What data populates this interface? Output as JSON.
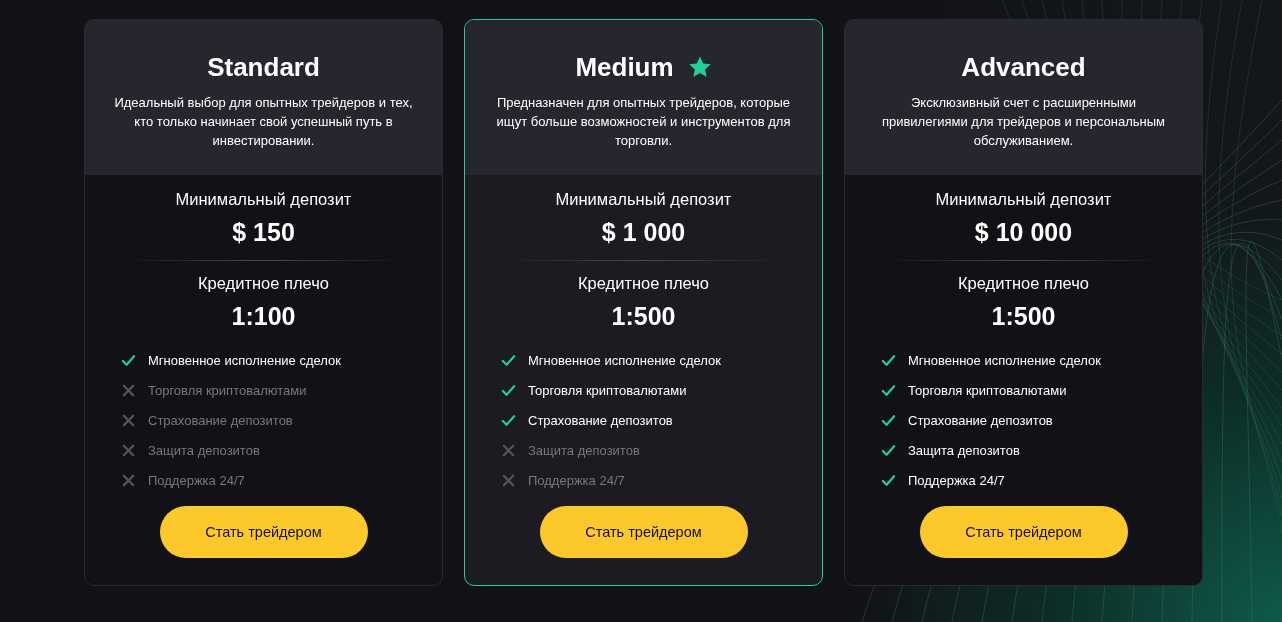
{
  "plans": [
    {
      "name": "Standard",
      "featured": false,
      "description": "Идеальный выбор для опытных трейдеров и тех, кто только начинает свой успешный путь в инвестировании.",
      "deposit_label": "Минимальный депозит",
      "deposit": "$ 150",
      "leverage_label": "Кредитное плечо",
      "leverage": "1:100",
      "features": [
        {
          "label": "Мгновенное исполнение сделок",
          "included": true
        },
        {
          "label": "Торговля криптовалютами",
          "included": false
        },
        {
          "label": "Страхование депозитов",
          "included": false
        },
        {
          "label": "Защита депозитов",
          "included": false
        },
        {
          "label": "Поддержка 24/7",
          "included": false
        }
      ],
      "button": "Стать трейдером"
    },
    {
      "name": "Medium",
      "featured": true,
      "description": "Предназначен для опытных трейдеров, которые ищут больше возможностей и инструментов для торговли.",
      "deposit_label": "Минимальный депозит",
      "deposit": "$ 1 000",
      "leverage_label": "Кредитное плечо",
      "leverage": "1:500",
      "features": [
        {
          "label": "Мгновенное исполнение сделок",
          "included": true
        },
        {
          "label": "Торговля криптовалютами",
          "included": true
        },
        {
          "label": "Страхование депозитов",
          "included": true
        },
        {
          "label": "Защита депозитов",
          "included": false
        },
        {
          "label": "Поддержка 24/7",
          "included": false
        }
      ],
      "button": "Стать трейдером"
    },
    {
      "name": "Advanced",
      "featured": false,
      "description": "Эксклюзивный счет с расширенными привилегиями для трейдеров и персональным обслуживанием.",
      "deposit_label": "Минимальный депозит",
      "deposit": "$ 10 000",
      "leverage_label": "Кредитное плечо",
      "leverage": "1:500",
      "features": [
        {
          "label": "Мгновенное исполнение сделок",
          "included": true
        },
        {
          "label": "Торговля криптовалютами",
          "included": true
        },
        {
          "label": "Страхование депозитов",
          "included": true
        },
        {
          "label": "Защита депозитов",
          "included": true
        },
        {
          "label": "Поддержка 24/7",
          "included": true
        }
      ],
      "button": "Стать трейдером"
    }
  ]
}
